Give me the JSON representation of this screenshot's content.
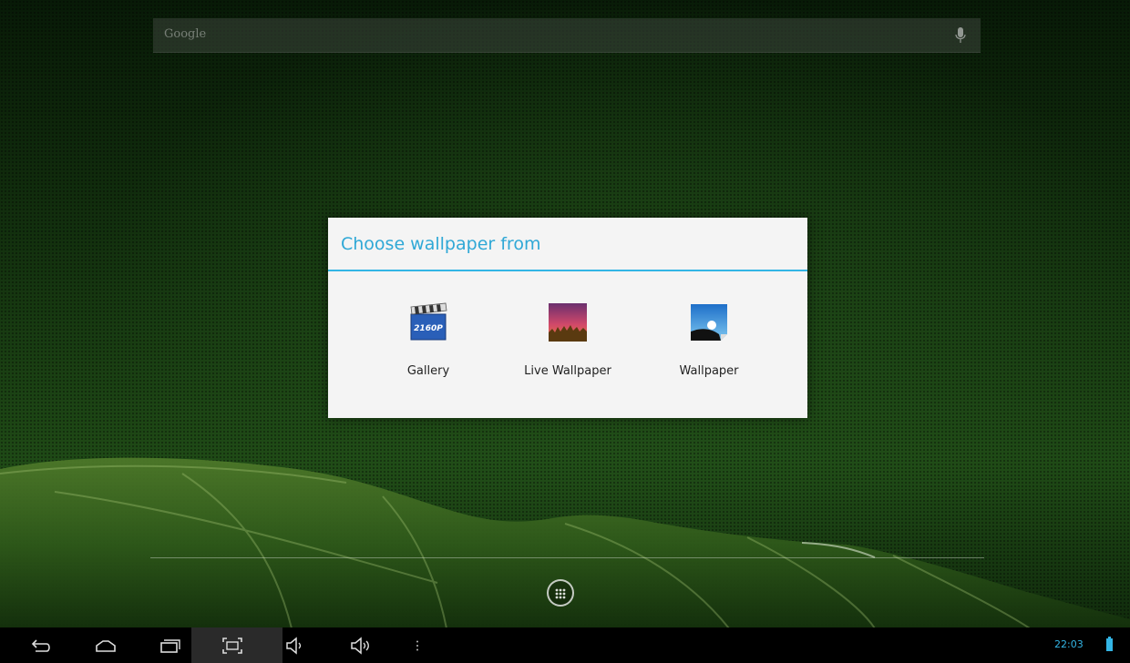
{
  "search": {
    "placeholder": "Google",
    "mic_icon": "microphone-icon"
  },
  "dialog": {
    "title": "Choose wallpaper from",
    "accent_color": "#33b5e5",
    "options": [
      {
        "label": "Gallery",
        "icon": "gallery-clapboard-icon",
        "icon_text": "2160P"
      },
      {
        "label": "Live Wallpaper",
        "icon": "live-wallpaper-icon"
      },
      {
        "label": "Wallpaper",
        "icon": "wallpaper-picture-icon"
      }
    ]
  },
  "dock": {
    "all_apps_icon": "all-apps-icon"
  },
  "nav_bar": {
    "buttons": [
      "back-icon",
      "home-icon",
      "recent-apps-icon",
      "screenshot-icon",
      "volume-down-icon",
      "volume-up-icon",
      "overflow-menu-icon"
    ],
    "clock": "22:03",
    "battery_icon": "battery-icon"
  }
}
